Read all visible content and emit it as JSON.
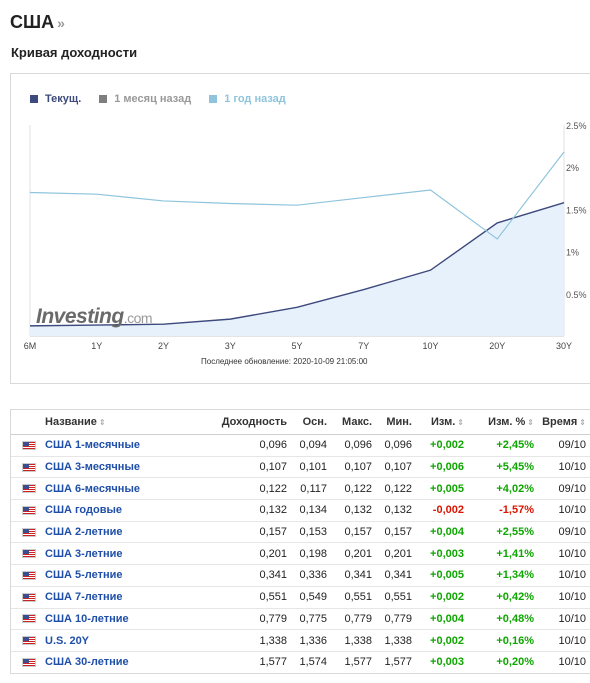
{
  "header": {
    "title": "США",
    "raquo": "»"
  },
  "section": {
    "title": "Кривая доходности"
  },
  "chart_data": {
    "type": "line",
    "categories": [
      "6M",
      "1Y",
      "2Y",
      "3Y",
      "5Y",
      "7Y",
      "10Y",
      "20Y",
      "30Y"
    ],
    "y_axis_side": "right",
    "ylim": [
      0,
      2.5
    ],
    "yticks": [
      "0.5%",
      "1%",
      "1.5%",
      "2%",
      "2.5%"
    ],
    "ytick_values": [
      0.5,
      1,
      1.5,
      2,
      2.5
    ],
    "legend_position": "top-left",
    "series": [
      {
        "name": "Текущ.",
        "color": "#3d4a7d",
        "area": true,
        "values": [
          0.12,
          0.13,
          0.14,
          0.2,
          0.34,
          0.55,
          0.78,
          1.34,
          1.58
        ]
      },
      {
        "name": "1 месяц назад",
        "color": "#7f7f7f",
        "hidden": true,
        "values": []
      },
      {
        "name": "1 год назад",
        "color": "#8ec4dc",
        "values": [
          1.7,
          1.68,
          1.6,
          1.57,
          1.55,
          1.64,
          1.73,
          1.15,
          2.18
        ]
      }
    ],
    "updated": "Последнее обновление: 2020-10-09 21:05:00",
    "watermark": {
      "main": "Investing",
      "suffix": ".com"
    }
  },
  "table": {
    "headers": {
      "name": "Название",
      "yield": "Доходность",
      "prev": "Осн.",
      "high": "Макс.",
      "low": "Мин.",
      "chg": "Изм.",
      "chg_pct": "Изм. %",
      "time": "Время"
    },
    "sort_icon": "⇕",
    "rows": [
      {
        "name": "США 1-месячные",
        "yield": "0,096",
        "prev": "0,094",
        "high": "0,096",
        "low": "0,096",
        "chg": "+0,002",
        "chg_pct": "+2,45%",
        "time": "09/10",
        "dir": "pos"
      },
      {
        "name": "США 3-месячные",
        "yield": "0,107",
        "prev": "0,101",
        "high": "0,107",
        "low": "0,107",
        "chg": "+0,006",
        "chg_pct": "+5,45%",
        "time": "10/10",
        "dir": "pos"
      },
      {
        "name": "США 6-месячные",
        "yield": "0,122",
        "prev": "0,117",
        "high": "0,122",
        "low": "0,122",
        "chg": "+0,005",
        "chg_pct": "+4,02%",
        "time": "09/10",
        "dir": "pos"
      },
      {
        "name": "США годовые",
        "yield": "0,132",
        "prev": "0,134",
        "high": "0,132",
        "low": "0,132",
        "chg": "-0,002",
        "chg_pct": "-1,57%",
        "time": "10/10",
        "dir": "neg"
      },
      {
        "name": "США 2-летние",
        "yield": "0,157",
        "prev": "0,153",
        "high": "0,157",
        "low": "0,157",
        "chg": "+0,004",
        "chg_pct": "+2,55%",
        "time": "09/10",
        "dir": "pos"
      },
      {
        "name": "США 3-летние",
        "yield": "0,201",
        "prev": "0,198",
        "high": "0,201",
        "low": "0,201",
        "chg": "+0,003",
        "chg_pct": "+1,41%",
        "time": "10/10",
        "dir": "pos"
      },
      {
        "name": "США 5-летние",
        "yield": "0,341",
        "prev": "0,336",
        "high": "0,341",
        "low": "0,341",
        "chg": "+0,005",
        "chg_pct": "+1,34%",
        "time": "10/10",
        "dir": "pos"
      },
      {
        "name": "США 7-летние",
        "yield": "0,551",
        "prev": "0,549",
        "high": "0,551",
        "low": "0,551",
        "chg": "+0,002",
        "chg_pct": "+0,42%",
        "time": "10/10",
        "dir": "pos"
      },
      {
        "name": "США 10-летние",
        "yield": "0,779",
        "prev": "0,775",
        "high": "0,779",
        "low": "0,779",
        "chg": "+0,004",
        "chg_pct": "+0,48%",
        "time": "10/10",
        "dir": "pos"
      },
      {
        "name": "U.S. 20Y",
        "yield": "1,338",
        "prev": "1,336",
        "high": "1,338",
        "low": "1,338",
        "chg": "+0,002",
        "chg_pct": "+0,16%",
        "time": "10/10",
        "dir": "pos"
      },
      {
        "name": "США 30-летние",
        "yield": "1,577",
        "prev": "1,574",
        "high": "1,577",
        "low": "1,577",
        "chg": "+0,003",
        "chg_pct": "+0,20%",
        "time": "10/10",
        "dir": "pos"
      }
    ]
  }
}
